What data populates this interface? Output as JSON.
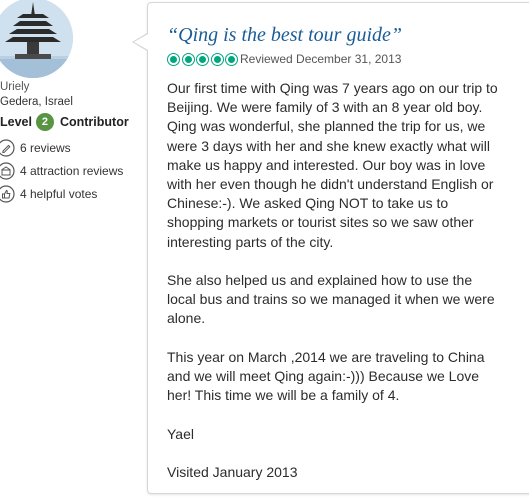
{
  "member": {
    "name": "Uriely",
    "location": "Gedera, Israel",
    "level_prefix": "Level",
    "level_number": "2",
    "level_suffix": "Contributor",
    "stats": [
      {
        "icon": "pencil-icon",
        "text": "6 reviews"
      },
      {
        "icon": "attraction-icon",
        "text": "4 attraction reviews"
      },
      {
        "icon": "thumbs-up-icon",
        "text": "4 helpful votes"
      }
    ]
  },
  "review": {
    "title": "“Qing is the best tour guide”",
    "rating": 5,
    "rating_max": 5,
    "reviewed_date": "Reviewed December 31, 2013",
    "paragraphs": [
      [
        "Our first time with Qing was 7 years ago on our trip to",
        "Beijing. We were family of 3 with an 8 year old boy.",
        "Qing was wonderful, she planned the trip for us, we",
        "were 3 days with her and she knew exactly what will",
        "make us happy and interested. Our boy was in love",
        "with her even though he didn't understand English or",
        "Chinese:-). We asked Qing NOT to take us to",
        "shopping markets or tourist sites so we saw other",
        "interesting parts of the city."
      ],
      [
        "She also helped us and explained how to use the",
        "local bus and trains so we managed it when we were",
        "alone."
      ],
      [
        "This year on March ,2014 we are traveling to China",
        "and we will meet Qing again:-))) Because we Love",
        "her! This time we will be a family of 4."
      ],
      [
        "Yael"
      ],
      [
        "Visited January 2013"
      ]
    ]
  },
  "colors": {
    "title": "#1a5d96",
    "bubble": "#00a680",
    "level_badge": "#589442"
  }
}
